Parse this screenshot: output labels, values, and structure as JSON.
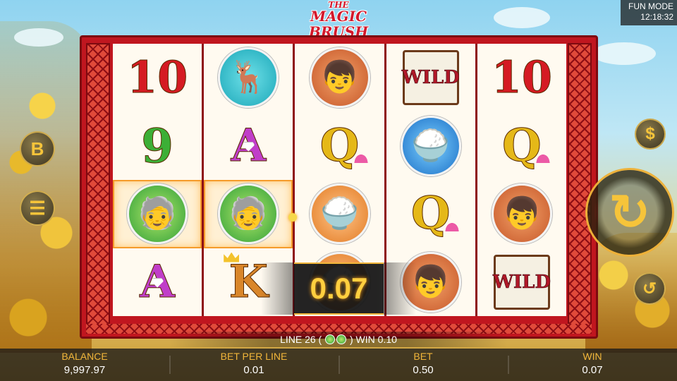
{
  "game": {
    "title_small": "THE",
    "title_main": "MAGIC BRUSH"
  },
  "mode": {
    "label": "FUN MODE",
    "clock": "12:18:32"
  },
  "reels": [
    [
      {
        "symbol": "ten",
        "text": "10",
        "win": false
      },
      {
        "symbol": "nine",
        "text": "9",
        "win": false
      },
      {
        "symbol": "sage",
        "text": "",
        "win": true
      },
      {
        "symbol": "ace",
        "text": "A",
        "win": false
      }
    ],
    [
      {
        "symbol": "deer",
        "text": "",
        "win": false
      },
      {
        "symbol": "ace",
        "text": "A",
        "win": false
      },
      {
        "symbol": "sage",
        "text": "",
        "win": true
      },
      {
        "symbol": "king",
        "text": "K",
        "win": false
      }
    ],
    [
      {
        "symbol": "boy",
        "text": "",
        "win": false
      },
      {
        "symbol": "queen",
        "text": "Q",
        "win": false
      },
      {
        "symbol": "rice",
        "text": "",
        "win": false
      },
      {
        "symbol": "rice",
        "text": "",
        "win": false
      }
    ],
    [
      {
        "symbol": "wild",
        "text": "WILD",
        "win": false
      },
      {
        "symbol": "rice",
        "text": "",
        "win": false
      },
      {
        "symbol": "queen",
        "text": "Q",
        "win": false
      },
      {
        "symbol": "boy",
        "text": "",
        "win": false
      }
    ],
    [
      {
        "symbol": "ten",
        "text": "10",
        "win": false
      },
      {
        "symbol": "queen",
        "text": "Q",
        "win": false
      },
      {
        "symbol": "boy",
        "text": "",
        "win": false
      },
      {
        "symbol": "wild",
        "text": "WILD",
        "win": false
      }
    ]
  ],
  "win_display": "0.07",
  "line_info": {
    "prefix": "LINE 26 (",
    "suffix": ") WIN 0.10"
  },
  "stats": {
    "balance_label": "BALANCE",
    "balance_value": "9,997.97",
    "bet_per_line_label": "BET PER LINE",
    "bet_per_line_value": "0.01",
    "bet_label": "BET",
    "bet_value": "0.50",
    "win_label": "WIN",
    "win_value": "0.07"
  },
  "buttons": {
    "bonus_label": "B",
    "menu_icon": "menu-icon",
    "coin_icon": "coin-icon",
    "spin_icon": "spin-icon",
    "autoplay_icon": "autoplay-icon"
  }
}
